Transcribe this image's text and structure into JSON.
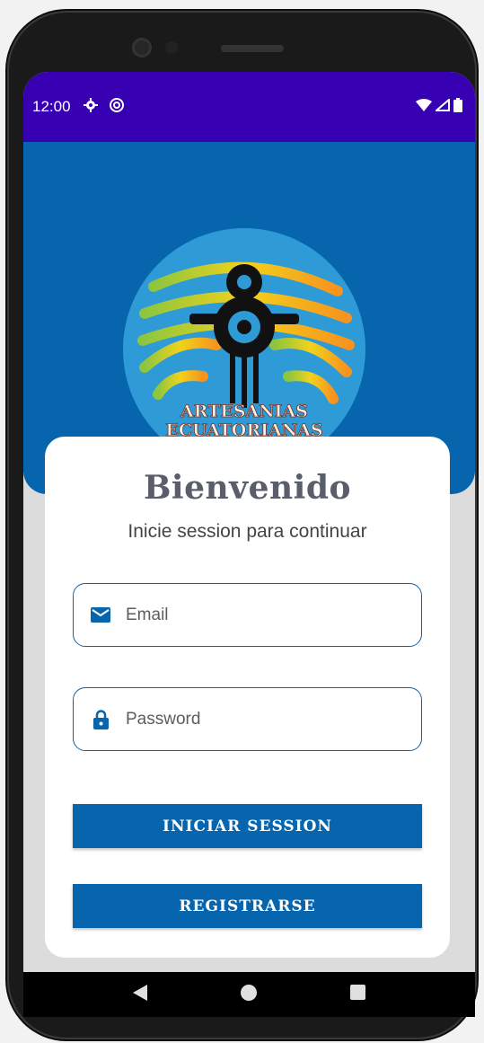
{
  "colors": {
    "status_bar": "#3700b3",
    "primary": "#0665ad",
    "field_border": "#1b5e9c",
    "title": "#5a5e6b"
  },
  "status_bar": {
    "time": "12:00",
    "icons": [
      "gear-icon",
      "sync-icon",
      "wifi-icon",
      "signal-icon",
      "battery-icon"
    ]
  },
  "logo": {
    "line1": "ARTESANIAS",
    "line2": "ECUATORIANAS"
  },
  "login": {
    "title": "Bienvenido",
    "subtitle": "Inicie session para continuar",
    "email_placeholder": "Email",
    "password_placeholder": "Password",
    "login_button": "INICIAR SESSION",
    "register_button": "REGISTRARSE"
  },
  "nav": {
    "icons": [
      "back-icon",
      "home-icon",
      "recents-icon"
    ]
  }
}
